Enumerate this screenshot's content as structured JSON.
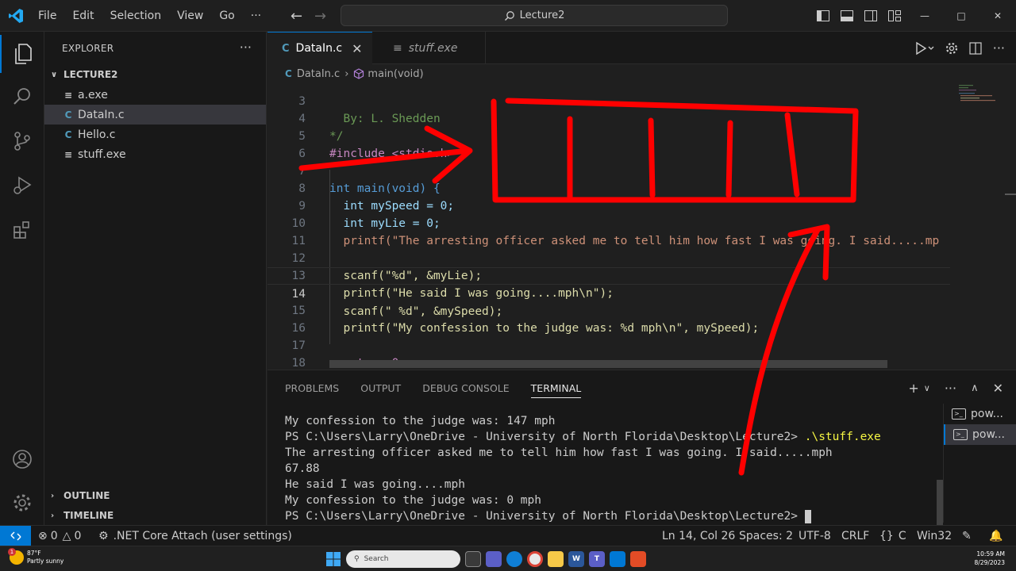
{
  "menu": [
    "File",
    "Edit",
    "Selection",
    "View",
    "Go",
    "···"
  ],
  "search": {
    "text": "Lecture2"
  },
  "sidebar": {
    "title": "EXPLORER",
    "folder": "LECTURE2",
    "files": [
      {
        "name": "a.exe",
        "type": "exe"
      },
      {
        "name": "DataIn.c",
        "type": "c"
      },
      {
        "name": "Hello.c",
        "type": "c"
      },
      {
        "name": "stuff.exe",
        "type": "exe"
      }
    ],
    "outline": "OUTLINE",
    "timeline": "TIMELINE"
  },
  "tabs": {
    "active": "DataIn.c",
    "inactive": "stuff.exe"
  },
  "breadcrumb": {
    "file": "DataIn.c",
    "symbol": "main(void)"
  },
  "editor": {
    "current_line": 14,
    "lines": [
      {
        "n": "3",
        "code": "  By: L. Shedden"
      },
      {
        "n": "4",
        "code": "*/"
      },
      {
        "n": "5",
        "code": "#include <stdio.h>"
      },
      {
        "n": "6",
        "code": ""
      },
      {
        "n": "7",
        "code": "int main(void) {"
      },
      {
        "n": "8",
        "code": "  int mySpeed = 0;"
      },
      {
        "n": "9",
        "code": "  int myLie = 0;"
      },
      {
        "n": "10",
        "code": "  printf(\"The arresting officer asked me to tell him how fast I was going. I said.....mp"
      },
      {
        "n": "11",
        "code": ""
      },
      {
        "n": "12",
        "code": "  scanf(\"%d\", &myLie);"
      },
      {
        "n": "13",
        "code": "  printf(\"He said I was going....mph\\n\");"
      },
      {
        "n": "14",
        "code": "  scanf(\" %d\", &mySpeed);"
      },
      {
        "n": "15",
        "code": "  printf(\"My confession to the judge was: %d mph\\n\", mySpeed);"
      },
      {
        "n": "16",
        "code": ""
      },
      {
        "n": "17",
        "code": "  return 0;"
      },
      {
        "n": "18",
        "code": "}"
      }
    ]
  },
  "panel": {
    "tabs": [
      "PROBLEMS",
      "OUTPUT",
      "DEBUG CONSOLE",
      "TERMINAL"
    ],
    "active_tab": "TERMINAL",
    "terminal_lines": [
      {
        "text": "My confession to the judge was: 147 mph",
        "cmd": ""
      },
      {
        "text": "PS C:\\Users\\Larry\\OneDrive - University of North Florida\\Desktop\\Lecture2> ",
        "cmd": ".\\stuff.exe"
      },
      {
        "text": "The arresting officer asked me to tell him how fast I was going. I said.....mph",
        "cmd": ""
      },
      {
        "text": "67.88",
        "cmd": ""
      },
      {
        "text": "He said I was going....mph",
        "cmd": ""
      },
      {
        "text": "My confession to the judge was: 0 mph",
        "cmd": ""
      },
      {
        "text": "PS C:\\Users\\Larry\\OneDrive - University of North Florida\\Desktop\\Lecture2> ",
        "cmd": ""
      }
    ],
    "terminals": [
      "pow...",
      "pow..."
    ]
  },
  "status": {
    "errors": "0",
    "warnings": "0",
    "attach": ".NET Core Attach (user settings)",
    "position": "Ln 14, Col 26",
    "spaces": "Spaces: 2",
    "encoding": "UTF-8",
    "eol": "CRLF",
    "language": "C",
    "platform": "Win32"
  },
  "taskbar": {
    "temp": "87°F",
    "weather": "Partly sunny",
    "badge": "1",
    "search": "Search",
    "time": "10:59 AM",
    "date": "8/29/2023"
  },
  "colors": {
    "accent": "#0078d4",
    "annotation": "#ff0000"
  }
}
